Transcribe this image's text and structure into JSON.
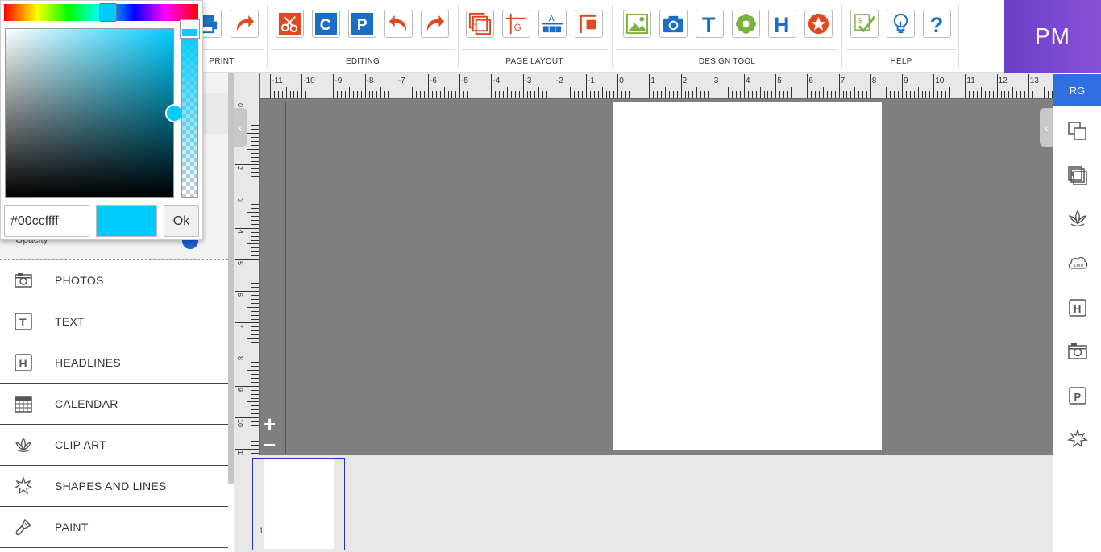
{
  "toolbar": {
    "groups": [
      {
        "label": "PRINT"
      },
      {
        "label": "EDITING"
      },
      {
        "label": "PAGE LAYOUT"
      },
      {
        "label": "DESIGN TOOL"
      },
      {
        "label": "HELP"
      }
    ],
    "buttons": {
      "print": "printer-icon",
      "save": "save-icon",
      "cut": "scissors-icon",
      "copy": "copy-icon",
      "paste": "paste-icon",
      "undo": "undo-icon",
      "redo": "redo-icon",
      "layers": "layers-icon",
      "grid": "grid-icon",
      "align": "align-icon",
      "background": "background-icon",
      "image": "image-icon",
      "camera": "camera-icon",
      "text": "text-icon",
      "clipart": "flower-icon",
      "headline": "headline-icon",
      "shapes": "star-icon",
      "checkout": "checkout-icon",
      "tips": "lightbulb-icon",
      "help": "question-icon"
    }
  },
  "badge": {
    "initials": "PM"
  },
  "right_sidebar": {
    "badge": "RG",
    "icons": [
      "resize-icon",
      "layers-icon",
      "lotus-icon",
      "cloud-com-icon",
      "headline-icon",
      "camera-icon",
      "paste-icon",
      "star-outline-icon"
    ]
  },
  "left_panel": {
    "opacity_label": "Opacity",
    "menu": [
      {
        "label": "PHOTOS",
        "icon": "camera-icon"
      },
      {
        "label": "TEXT",
        "icon": "text-icon"
      },
      {
        "label": "HEADLINES",
        "icon": "headline-icon"
      },
      {
        "label": "CALENDAR",
        "icon": "calendar-icon"
      },
      {
        "label": "CLIP ART",
        "icon": "lotus-icon"
      },
      {
        "label": "SHAPES AND LINES",
        "icon": "star-outline-icon"
      },
      {
        "label": "PAINT",
        "icon": "paintbrush-icon"
      }
    ]
  },
  "color_picker": {
    "hex_value": "#00ccffff",
    "ok_label": "Ok",
    "current_color": "#00ccff"
  },
  "ruler": {
    "top_labels": [
      "-11",
      "-10",
      "-9",
      "-8",
      "-7",
      "-6",
      "-5",
      "-4",
      "-3",
      "-2",
      "-1",
      "0",
      "1",
      "2",
      "3",
      "4",
      "5",
      "6",
      "7",
      "8",
      "9",
      "10",
      "11",
      "12",
      "13"
    ],
    "left_labels": [
      "0",
      "1",
      "2",
      "3",
      "4",
      "5",
      "6",
      "7",
      "8",
      "9",
      "10",
      "11"
    ]
  },
  "canvas": {
    "zoom_in": "+",
    "zoom_out": "−"
  },
  "thumbnails": [
    {
      "number": "1"
    }
  ],
  "colors": {
    "accent_orange": "#e0491f",
    "accent_blue": "#1a6fc4",
    "accent_green": "#7ab33e",
    "badge_purple": "#7a48d0",
    "rg_blue": "#2f6fe0"
  }
}
